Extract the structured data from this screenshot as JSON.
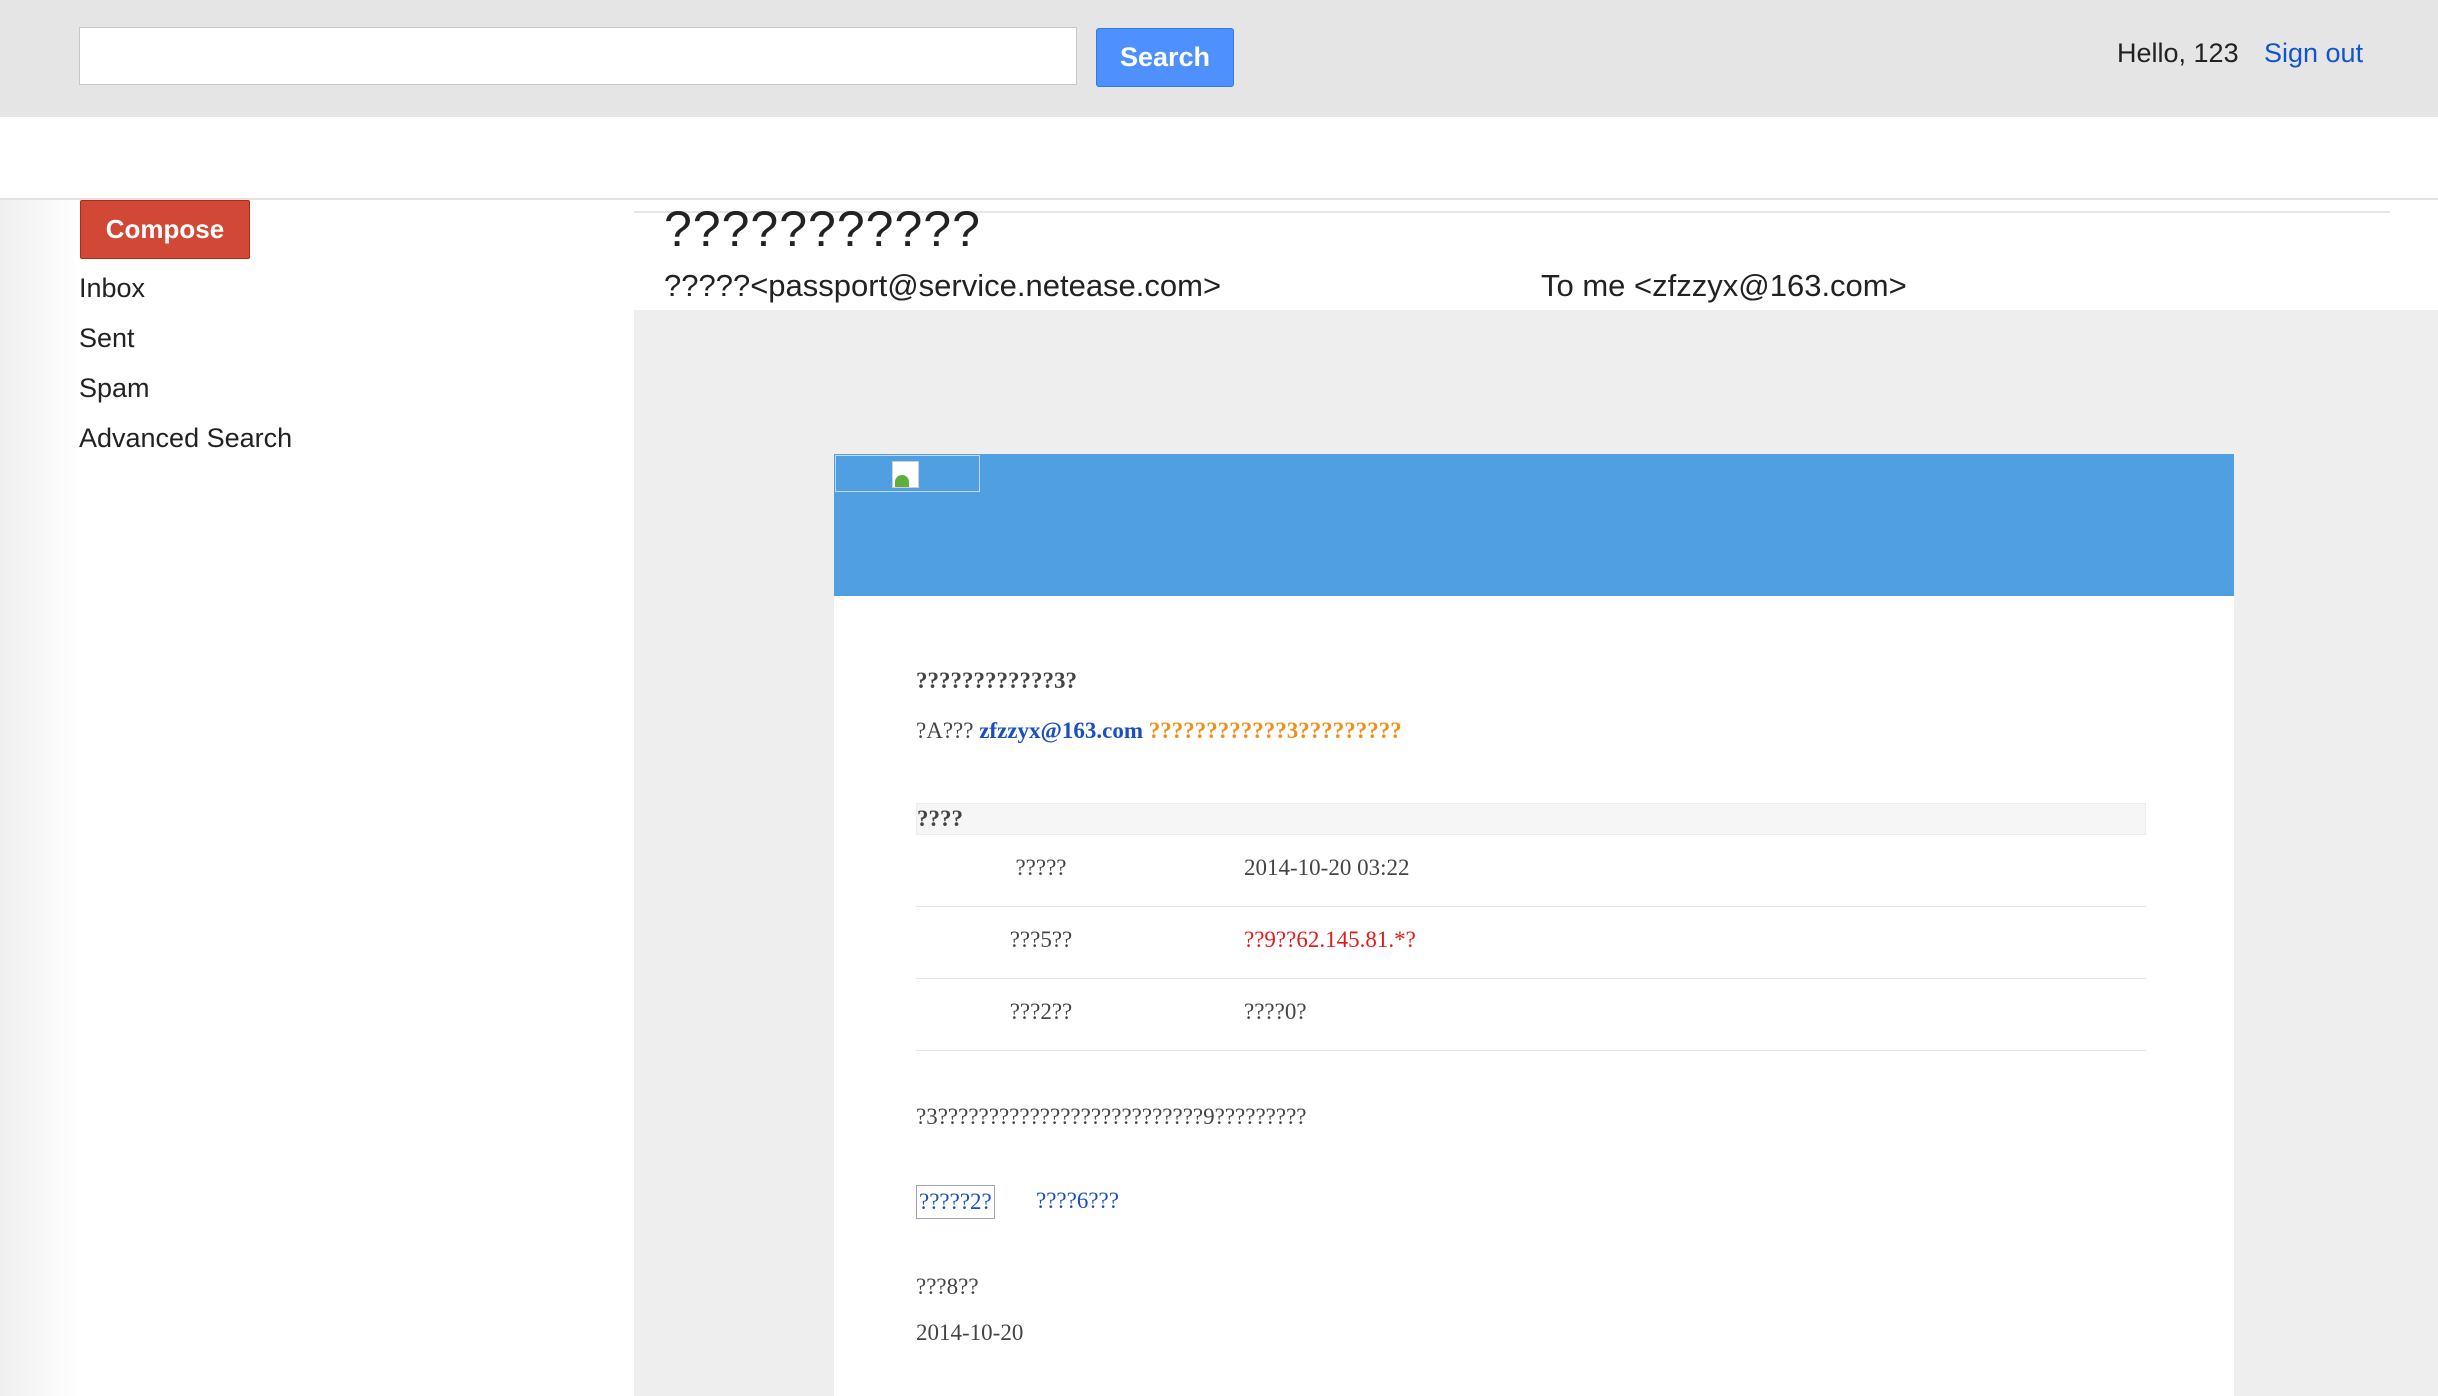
{
  "header": {
    "search_value": "",
    "search_button": "Search",
    "greeting": "Hello, 123",
    "sign_out": "Sign out"
  },
  "sidebar": {
    "compose": "Compose",
    "items": [
      {
        "label": "Inbox"
      },
      {
        "label": "Sent"
      },
      {
        "label": "Spam"
      },
      {
        "label": "Advanced Search"
      }
    ]
  },
  "message": {
    "subject": "???????????",
    "from": "?????<passport@service.netease.com>",
    "to": "To me <zfzzyx@163.com>",
    "body": {
      "greeting": "????????????3?",
      "notice_prefix": "?A??? ",
      "notice_email": "zfzzyx@163.com",
      "notice_warning": " ????????????3?????????",
      "details_title": "????",
      "details": [
        {
          "key": "?????",
          "value": "2014-10-20 03:22",
          "highlight": false
        },
        {
          "key": "???5??",
          "value": "??9??62.145.81.*?",
          "highlight": true
        },
        {
          "key": "???2??",
          "value": "????0?",
          "highlight": false
        }
      ],
      "tip": "?3??????????????????????????9?????????",
      "link_primary": "?????2?",
      "link_secondary": "????6???",
      "signature": "???8??",
      "date": "2014-10-20"
    }
  },
  "colors": {
    "search_button": "#4d90fe",
    "compose_button": "#d14836",
    "banner": "#4f9fe2",
    "link": "#1155cc",
    "warning": "#f0901a",
    "alert": "#e4191a"
  }
}
